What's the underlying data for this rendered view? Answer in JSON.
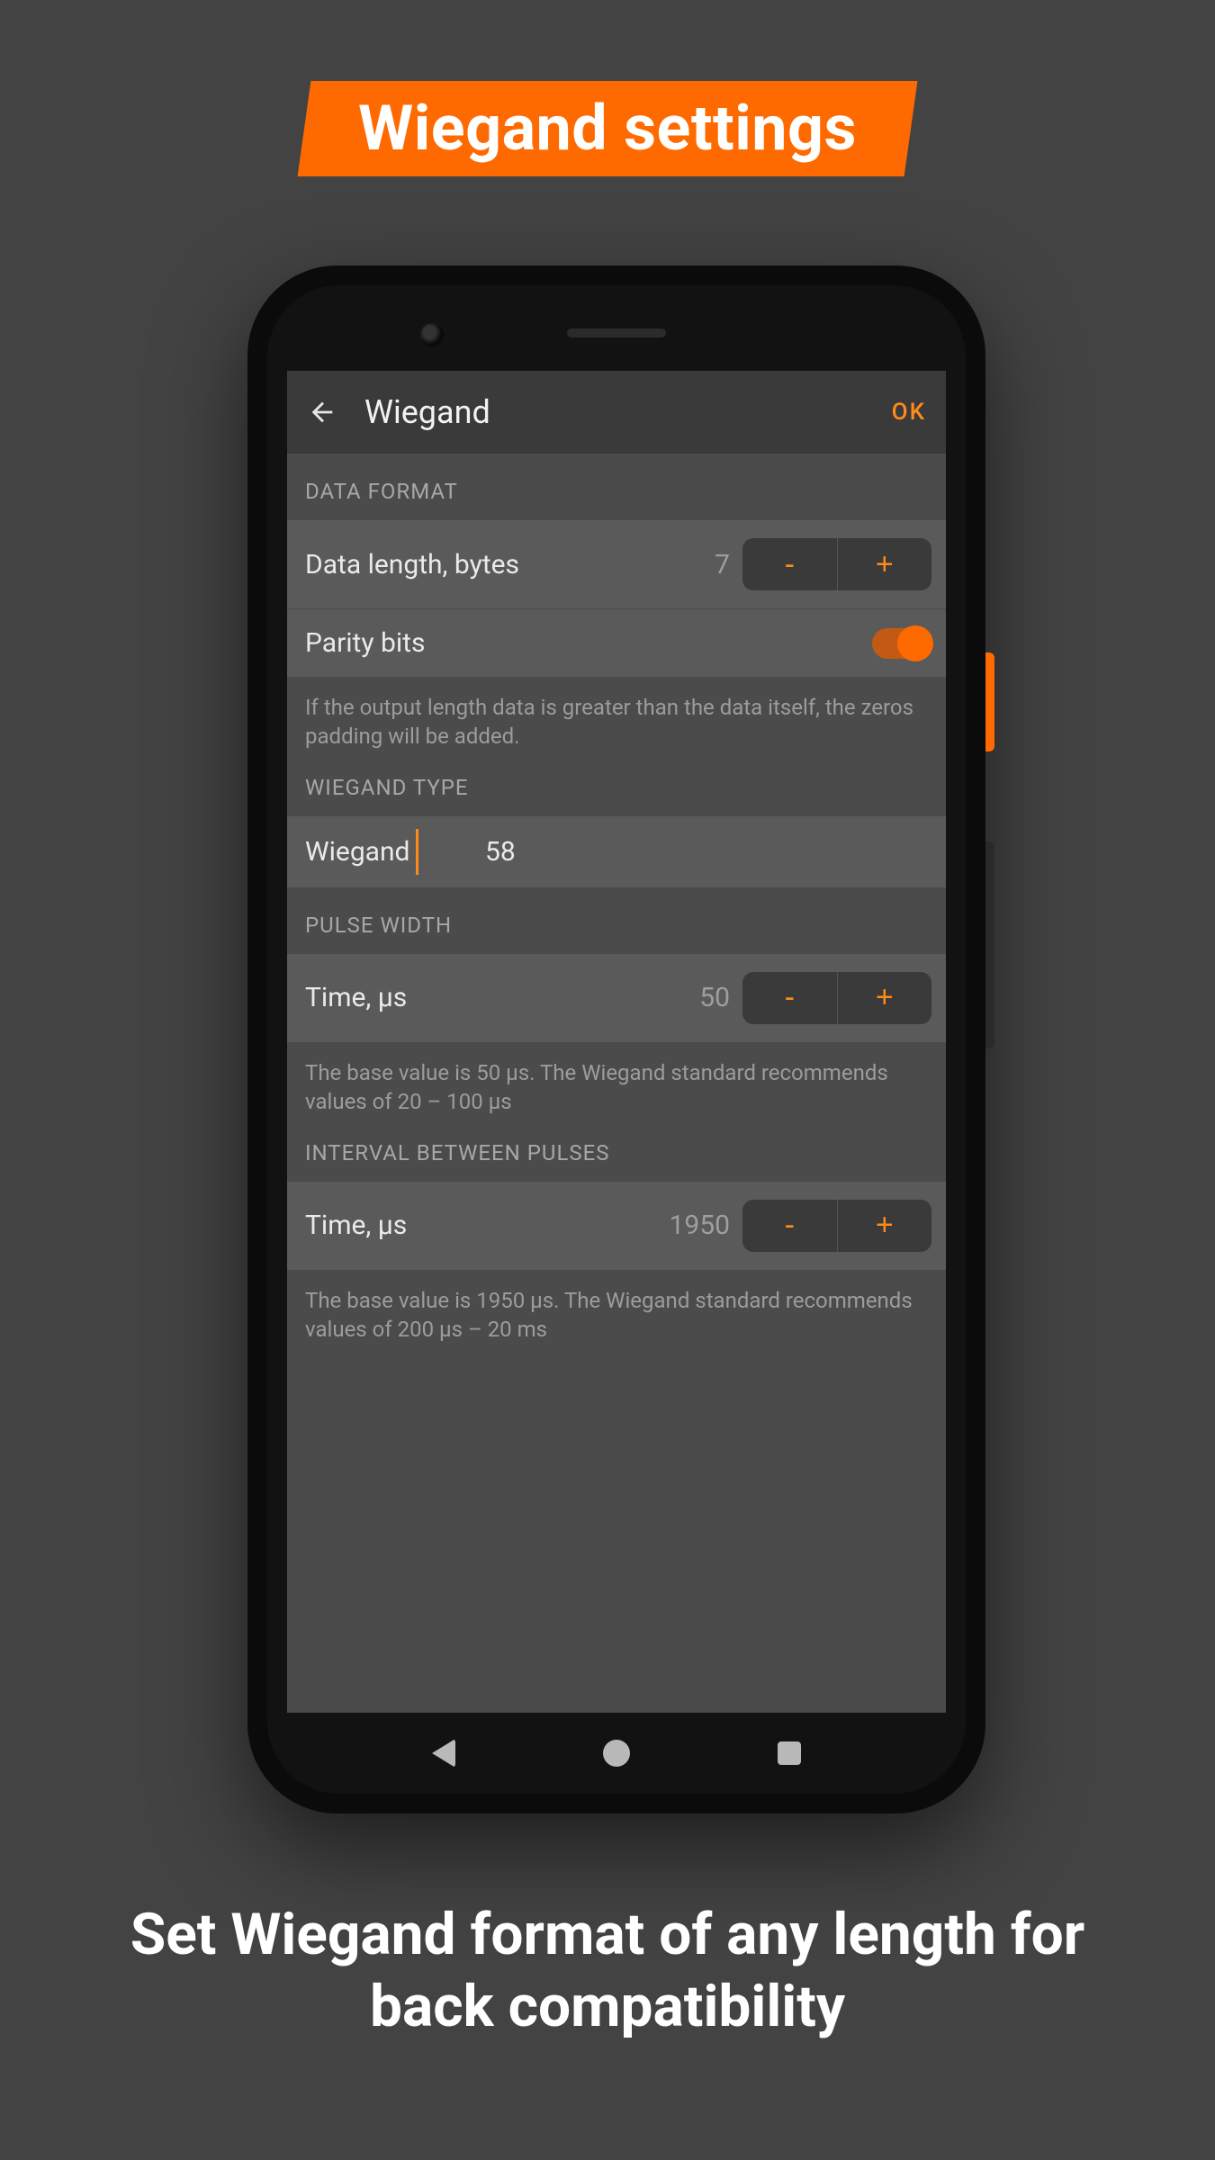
{
  "banner": {
    "title": "Wiegand settings"
  },
  "appbar": {
    "title": "Wiegand",
    "ok": "OK"
  },
  "sections": {
    "data_format": {
      "header": "DATA FORMAT",
      "data_length": {
        "label": "Data length, bytes",
        "value": "7",
        "minus": "-",
        "plus": "+"
      },
      "parity": {
        "label": "Parity bits",
        "on": true
      },
      "note": "If the output length data is greater than the data itself, the zeros padding will be added."
    },
    "wiegand_type": {
      "header": "WIEGAND TYPE",
      "label": "Wiegand",
      "value": "58"
    },
    "pulse_width": {
      "header": "PULSE WIDTH",
      "time": {
        "label": "Time, μs",
        "value": "50",
        "minus": "-",
        "plus": "+"
      },
      "note": "The base value is 50 μs. The Wiegand standard recommends values of 20 – 100 μs"
    },
    "interval": {
      "header": "INTERVAL BETWEEN PULSES",
      "time": {
        "label": "Time, μs",
        "value": "1950",
        "minus": "-",
        "plus": "+"
      },
      "note": "The base value is 1950 μs. The Wiegand standard recommends values of 200 μs – 20 ms"
    }
  },
  "caption": "Set Wiegand format of any length for back compatibility",
  "colors": {
    "accent": "#ff6a00"
  }
}
